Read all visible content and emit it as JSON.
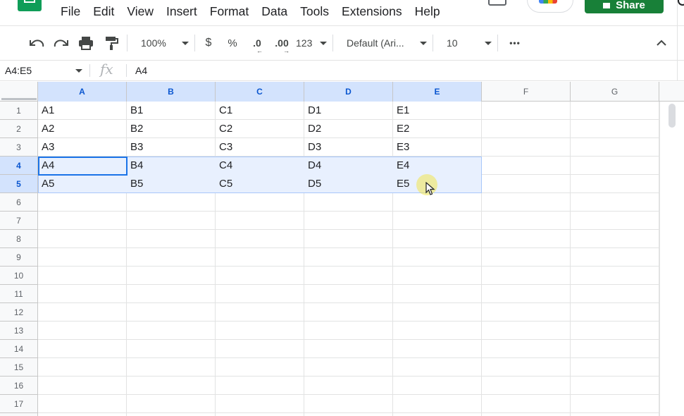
{
  "menu": [
    "File",
    "Edit",
    "View",
    "Insert",
    "Format",
    "Data",
    "Tools",
    "Extensions",
    "Help"
  ],
  "share_label": "Share",
  "toolbar": {
    "zoom": "100%",
    "currency": "$",
    "percent": "%",
    "dec_decrease": ".0",
    "dec_increase": ".00",
    "number_format": "123",
    "font": "Default (Ari...",
    "font_size": "10",
    "more": "•••"
  },
  "formula_bar": {
    "name_box": "A4:E5",
    "fx": "fx",
    "value": "A4"
  },
  "columns": [
    "A",
    "B",
    "C",
    "D",
    "E",
    "F",
    "G"
  ],
  "rows": [
    "1",
    "2",
    "3",
    "4",
    "5",
    "6",
    "7",
    "8",
    "9",
    "10",
    "11",
    "12",
    "13",
    "14",
    "15",
    "16",
    "17"
  ],
  "cells": [
    [
      "A1",
      "B1",
      "C1",
      "D1",
      "E1"
    ],
    [
      "A2",
      "B2",
      "C2",
      "D2",
      "E2"
    ],
    [
      "A3",
      "B3",
      "C3",
      "D3",
      "E3"
    ],
    [
      "A4",
      "B4",
      "C4",
      "D4",
      "E4"
    ],
    [
      "A5",
      "B5",
      "C5",
      "D5",
      "E5"
    ]
  ],
  "selection": {
    "range": "A4:E5",
    "active": "A4"
  },
  "colors": {
    "accent": "#1a73e8",
    "selection_fill": "#e8f0fe",
    "share": "#188038"
  }
}
